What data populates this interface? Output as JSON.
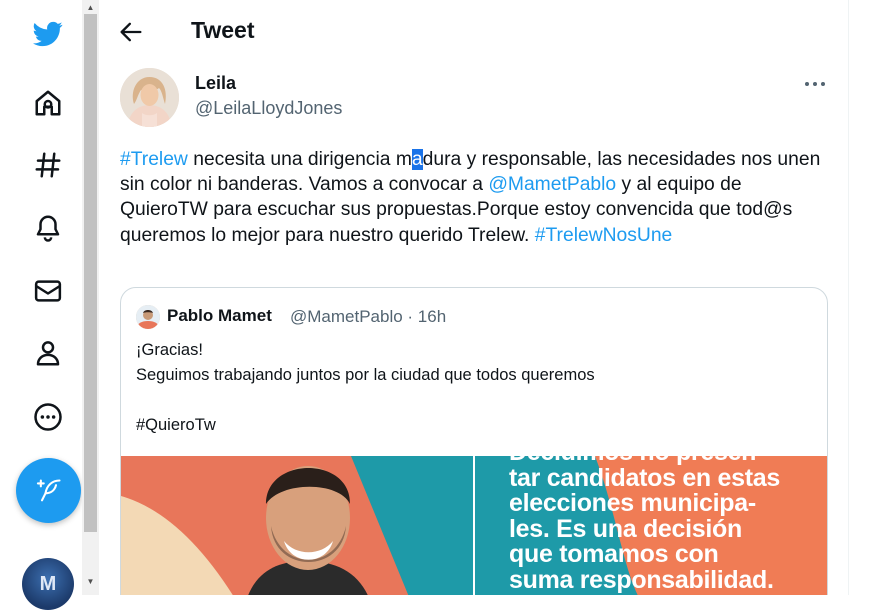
{
  "page": {
    "title": "Tweet"
  },
  "colors": {
    "brand": "#1d9bf0",
    "text": "#0f1419",
    "muted": "#536471",
    "border": "#cfd9de"
  },
  "sidebar": {
    "icons": [
      "twitter-logo-icon",
      "home-icon",
      "explore-hashtag-icon",
      "notifications-bell-icon",
      "messages-envelope-icon",
      "profile-person-icon",
      "more-circle-icon"
    ],
    "compose_icon": "feather-plus-icon",
    "avatar_label": "M"
  },
  "tweet": {
    "author_name": "Leila",
    "author_handle": "@LeilaLloydJones",
    "text_parts": {
      "hashtag1": "#Trelew",
      "part1": " necesita una dirigencia m",
      "selected": "a",
      "part2": "dura y responsable, las necesidades nos unen sin color ni banderas. Vamos a convocar a ",
      "mention": "@MametPablo",
      "part3": " y al equipo de QuieroTW para escuchar sus propuestas.Porque estoy convencida que tod@s queremos lo mejor para nuestro querido Trelew. ",
      "hashtag2": "#TrelewNosUne"
    }
  },
  "quote": {
    "name": "Pablo Mamet",
    "meta": "@MametPablo · 16h",
    "text": "¡Gracias!\nSeguimos trabajando juntos por la ciudad que todos queremos\n\n#QuieroTw",
    "media_text": "Decidimos no presen-\ntar candidatos en estas\nelecciones municipa-\nles. Es una decisión\nque tomamos con\nsuma responsabilidad."
  }
}
